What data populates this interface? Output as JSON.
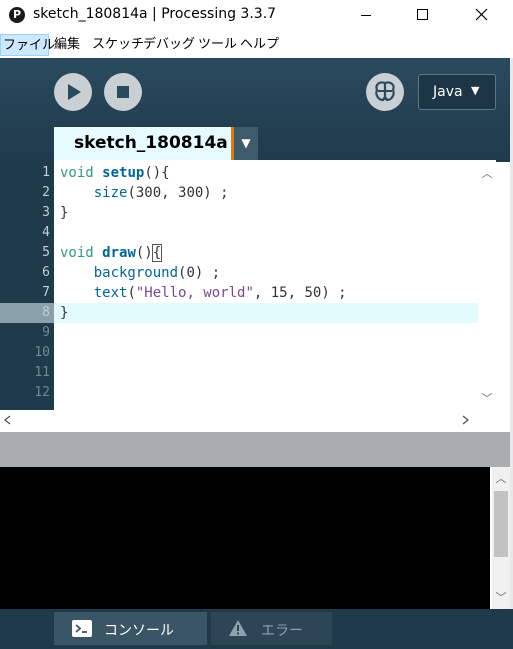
{
  "window": {
    "title": "sketch_180814a | Processing 3.3.7",
    "app_icon_glyph": "P",
    "controls": {
      "minimize": "minimize-icon",
      "maximize": "maximize-icon",
      "close": "close-icon"
    }
  },
  "menu": [
    "ファイル",
    "編集",
    "スケッチ",
    "デバッグ",
    "ツール",
    "ヘルプ"
  ],
  "toolbar": {
    "run_icon": "play-icon",
    "stop_icon": "stop-icon",
    "debug_icon": "butterfly-icon",
    "mode_label": "Java",
    "mode_arrow": "▼"
  },
  "tab": {
    "label": "sketch_180814a",
    "menu_arrow": "▼"
  },
  "editor": {
    "line_numbers": [
      "1",
      "2",
      "3",
      "4",
      "5",
      "6",
      "7",
      "8",
      "9",
      "10",
      "11",
      "12"
    ],
    "current_line": 8,
    "code": [
      "void setup(){",
      "    size(300, 300) ;",
      "}",
      "",
      "void draw(){",
      "    background(0) ;",
      "    text(\"Hello, world\", 15, 50) ;",
      "}"
    ]
  },
  "footer": {
    "console_label": "コンソール",
    "errors_label": "エラー",
    "console_icon": "terminal-icon",
    "errors_icon": "warning-icon"
  },
  "colors": {
    "header_bg": "#1f3a4b",
    "editor_bg": "#ffffff",
    "current_line_bg": "#e2fbfd",
    "keyword_type": "#33997e",
    "keyword_function": "#006699",
    "string": "#7d4793",
    "tab_accent": "#e07a10"
  }
}
